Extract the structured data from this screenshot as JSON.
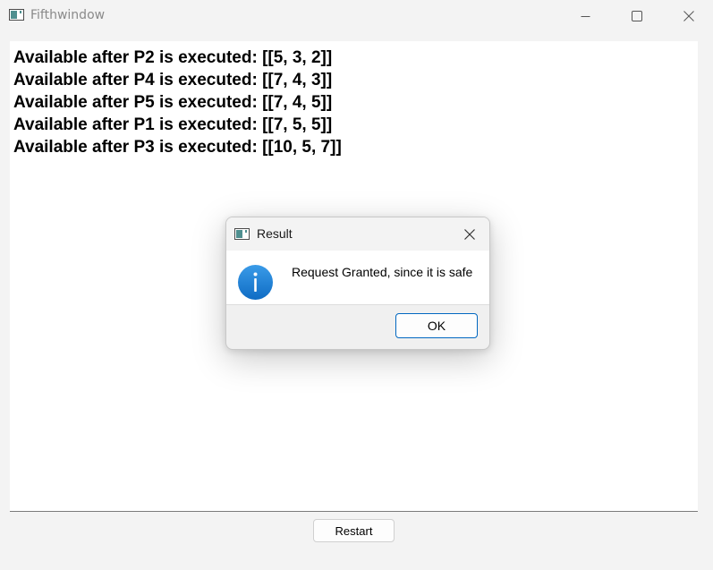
{
  "window": {
    "title": "Fifthwindow",
    "icon": "app-window-icon"
  },
  "log": {
    "lines": [
      "Available after P2 is executed: [[5, 3, 2]]",
      "Available after P4 is executed: [[7, 4, 3]]",
      "Available after P5 is executed: [[7, 4, 5]]",
      "Available after P1 is executed: [[7, 5, 5]]",
      "Available after P3 is executed: [[10, 5, 7]]"
    ]
  },
  "footer": {
    "restart_label": "Restart"
  },
  "dialog": {
    "title": "Result",
    "message": "Request Granted, since it is safe",
    "ok_label": "OK",
    "icon": "info-icon",
    "accent_color": "#0067c0"
  },
  "colors": {
    "window_background": "#f3f3f3",
    "content_background": "#ffffff",
    "info_icon_blue": "#1a7fd4"
  }
}
